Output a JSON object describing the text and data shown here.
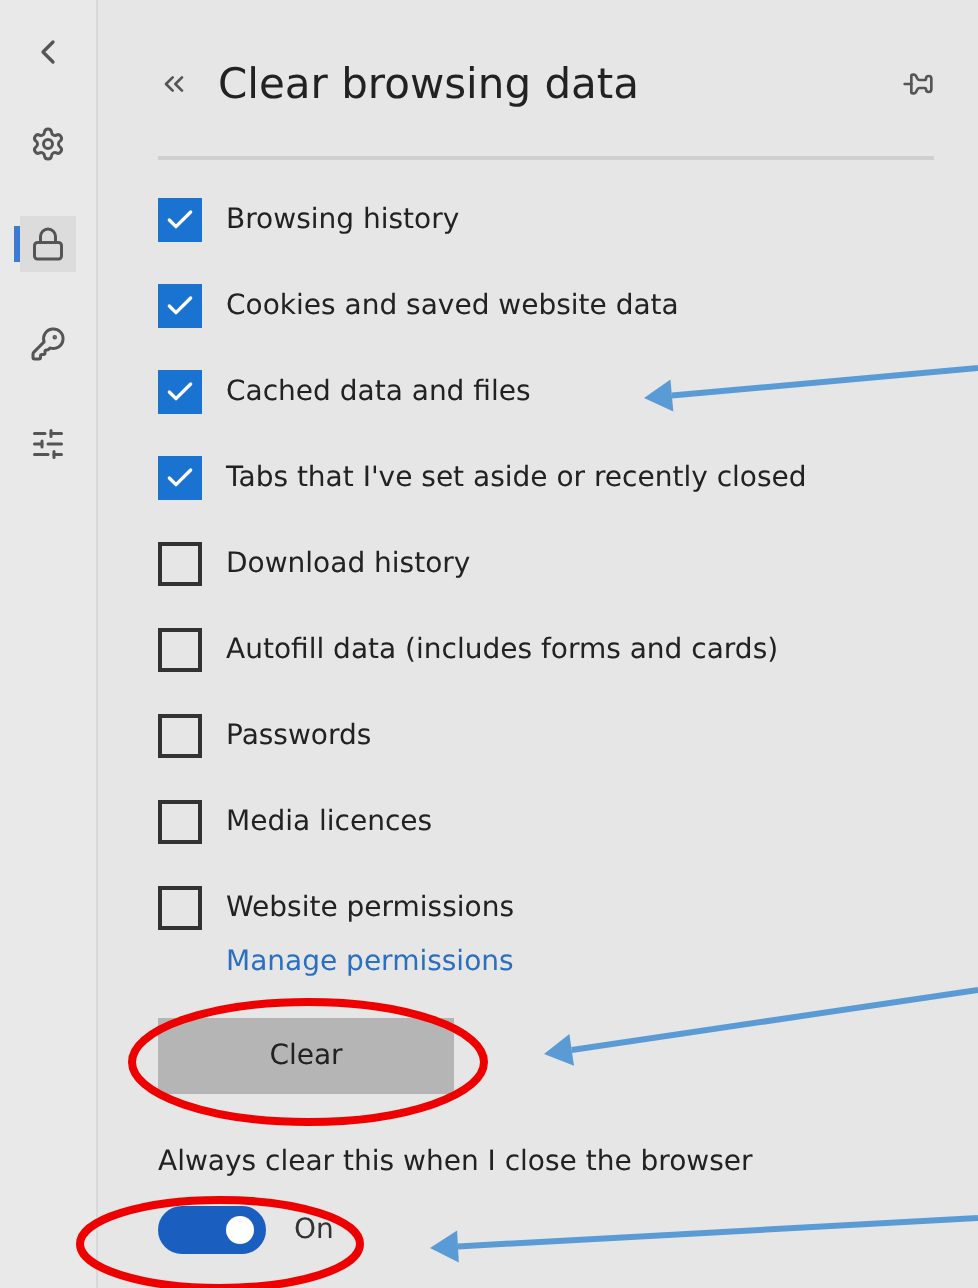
{
  "nav_rail": {
    "items": [
      {
        "kind": "settings",
        "selected": false
      },
      {
        "kind": "privacy",
        "selected": true
      },
      {
        "kind": "passwords",
        "selected": false
      },
      {
        "kind": "advanced",
        "selected": false
      }
    ]
  },
  "panel": {
    "title": "Clear browsing data",
    "options": [
      {
        "label": "Browsing history",
        "checked": true
      },
      {
        "label": "Cookies and saved website data",
        "checked": true
      },
      {
        "label": "Cached data and files",
        "checked": true
      },
      {
        "label": "Tabs that I've set aside or recently closed",
        "checked": true
      },
      {
        "label": "Download history",
        "checked": false
      },
      {
        "label": "Autofill data (includes forms and cards)",
        "checked": false
      },
      {
        "label": "Passwords",
        "checked": false
      },
      {
        "label": "Media licences",
        "checked": false
      },
      {
        "label": "Website permissions",
        "checked": false
      }
    ],
    "manage_link": "Manage permissions",
    "clear_button": "Clear",
    "always_clear": {
      "label": "Always clear this when I close the browser",
      "on": true,
      "state_text": "On"
    }
  }
}
